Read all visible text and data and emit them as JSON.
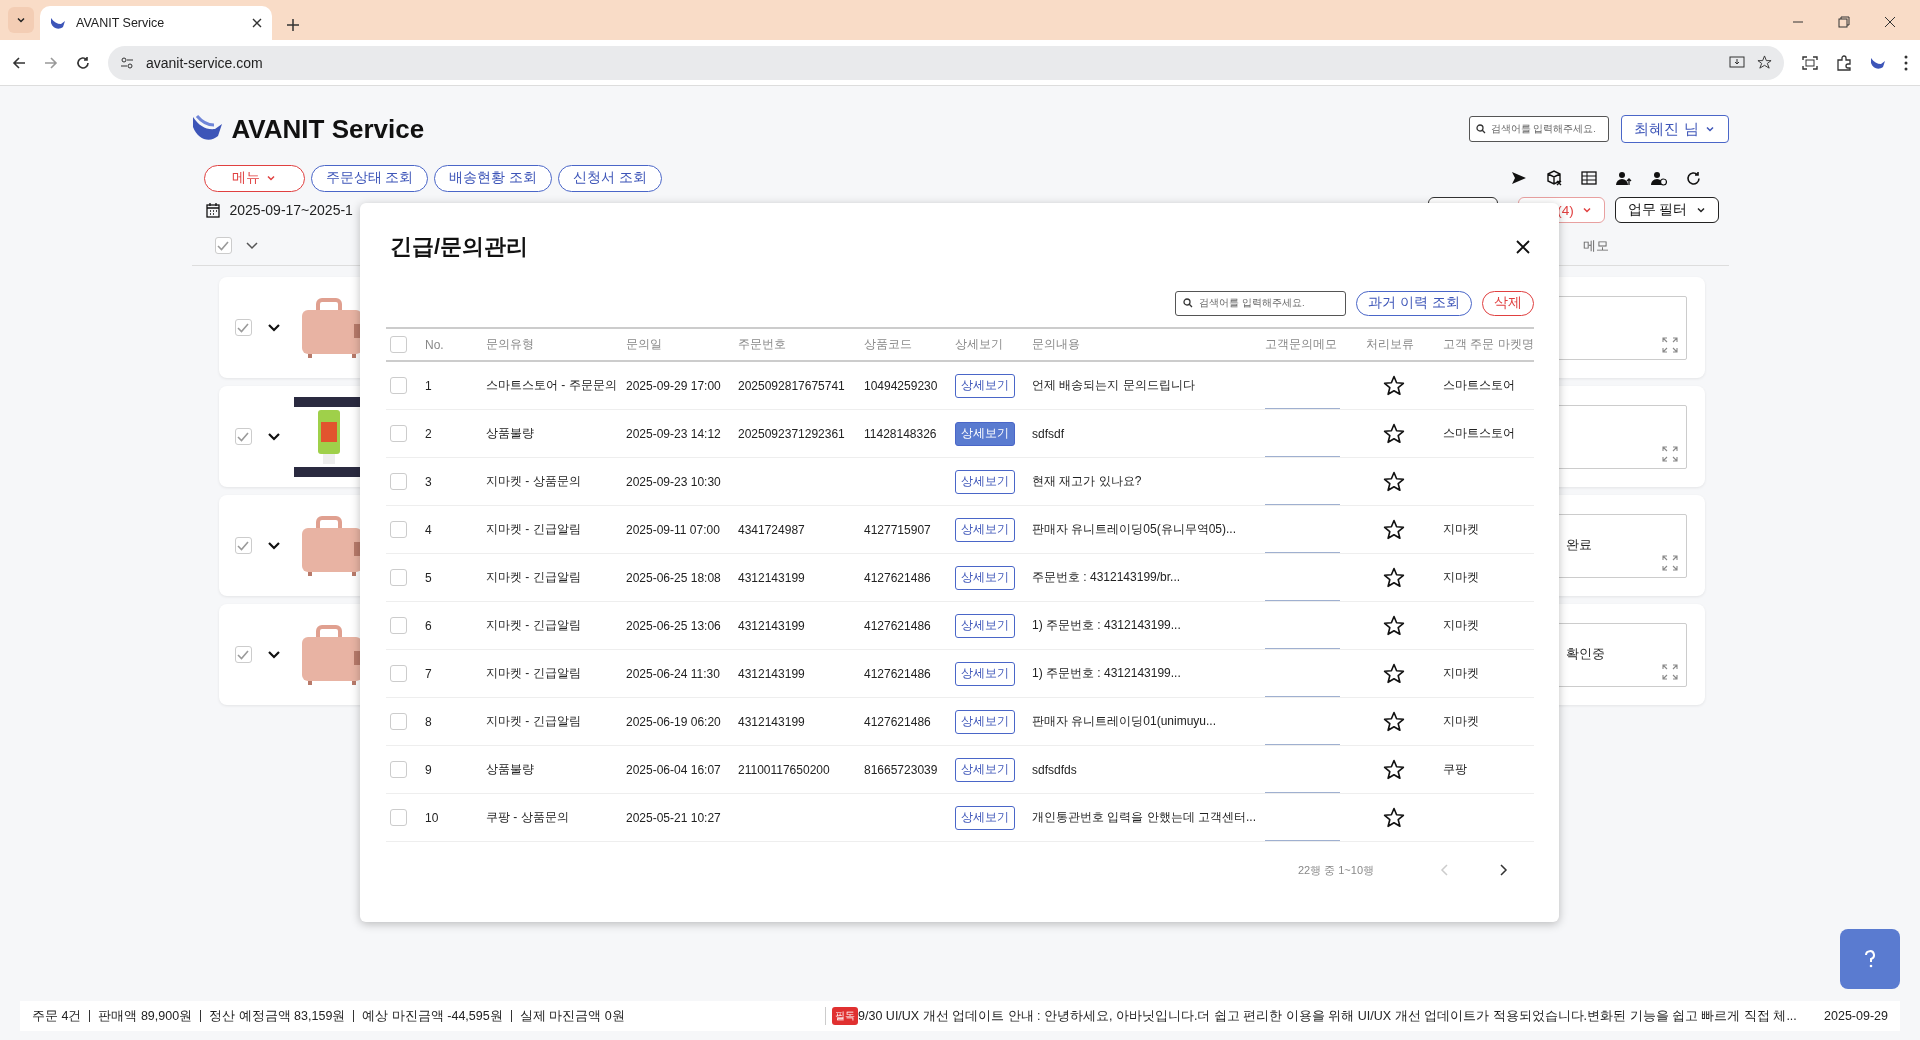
{
  "browser": {
    "tab_title": "AVANIT Service",
    "url": "avanit-service.com"
  },
  "header": {
    "brand": "AVANIT Service",
    "search": {
      "placeholder": "검색어를 입력해주세요."
    },
    "user": "최혜진 님"
  },
  "nav": [
    {
      "label": "메뉴",
      "kind": "menu"
    },
    {
      "label": "주문상태 조회",
      "kind": "link"
    },
    {
      "label": "배송현황 조회",
      "kind": "link"
    },
    {
      "label": "신청서 조회",
      "kind": "link"
    }
  ],
  "date_range": "2025-09-17~2025-1",
  "filters": [
    {
      "label": "(4)",
      "alert": true
    },
    {
      "label": "업무 필터",
      "alert": false
    }
  ],
  "list_header": {
    "checked": true,
    "memo": "메모"
  },
  "cards": [
    {
      "checked": true,
      "kind": "picture"
    },
    {
      "checked": true,
      "kind": "picture"
    },
    {
      "checked": true,
      "kind": "picture",
      "memo": "완료"
    },
    {
      "checked": true,
      "kind": "picture",
      "memo": "확인중"
    }
  ],
  "modal": {
    "title": "긴급/문의관리",
    "search": {
      "placeholder": "검색어를 입력해주세요."
    },
    "buttons": [
      {
        "label": "과거 이력 조회",
        "kind": "secondary"
      },
      {
        "label": "삭제",
        "kind": "danger"
      }
    ],
    "header_checked": false,
    "columns": [
      "No.",
      "문의유형",
      "문의일",
      "주문번호",
      "상품코드",
      "상세보기",
      "문의내용",
      "고객문의메모",
      "처리보류",
      "고객 주문 마켓명"
    ],
    "rows": [
      {
        "checked": false,
        "no": "1",
        "type": "스마트스토어 - 주문문의",
        "date": "2025-09-29 17:00",
        "order_no": "2025092817675741",
        "product_code": "10494259230",
        "detail": "상세보기",
        "hovered": false,
        "content": "언제 배송되는지 문의드립니다",
        "starred": false,
        "market": "스마트스토어"
      },
      {
        "checked": false,
        "no": "2",
        "type": "상품불량",
        "date": "2025-09-23 14:12",
        "order_no": "2025092371292361",
        "product_code": "11428148326",
        "detail": "상세보기",
        "hovered": true,
        "content": "sdfsdf",
        "starred": false,
        "market": "스마트스토어"
      },
      {
        "checked": false,
        "no": "3",
        "type": "지마켓 - 상품문의",
        "date": "2025-09-23 10:30",
        "detail": "상세보기",
        "hovered": false,
        "content": "현재 재고가 있나요?",
        "starred": false
      },
      {
        "checked": false,
        "no": "4",
        "type": "지마켓 - 긴급알림",
        "date": "2025-09-11 07:00",
        "order_no": "4341724987",
        "product_code": "4127715907",
        "detail": "상세보기",
        "hovered": false,
        "content": "판매자 유니트레이딩05(유니무역05)...",
        "starred": false,
        "market": "지마켓"
      },
      {
        "checked": false,
        "no": "5",
        "type": "지마켓 - 긴급알림",
        "date": "2025-06-25 18:08",
        "order_no": "4312143199",
        "product_code": "4127621486",
        "detail": "상세보기",
        "hovered": false,
        "content": "주문번호 : 4312143199/br...",
        "starred": false,
        "market": "지마켓"
      },
      {
        "checked": false,
        "no": "6",
        "type": "지마켓 - 긴급알림",
        "date": "2025-06-25 13:06",
        "order_no": "4312143199",
        "product_code": "4127621486",
        "detail": "상세보기",
        "hovered": false,
        "content": "1) 주문번호 : 4312143199...",
        "starred": false,
        "market": "지마켓"
      },
      {
        "checked": false,
        "no": "7",
        "type": "지마켓 - 긴급알림",
        "date": "2025-06-24 11:30",
        "order_no": "4312143199",
        "product_code": "4127621486",
        "detail": "상세보기",
        "hovered": false,
        "content": "1) 주문번호 : 4312143199...",
        "starred": false,
        "market": "지마켓"
      },
      {
        "checked": false,
        "no": "8",
        "type": "지마켓 - 긴급알림",
        "date": "2025-06-19 06:20",
        "order_no": "4312143199",
        "product_code": "4127621486",
        "detail": "상세보기",
        "hovered": false,
        "content": "판매자 유니트레이딩01(unimuyu...",
        "starred": false,
        "market": "지마켓"
      },
      {
        "checked": false,
        "no": "9",
        "type": "상품불량",
        "date": "2025-06-04 16:07",
        "order_no": "21100117650200",
        "product_code": "81665723039",
        "detail": "상세보기",
        "hovered": false,
        "content": "sdfsdfds",
        "starred": false,
        "market": "쿠팡"
      },
      {
        "checked": false,
        "no": "10",
        "type": "쿠팡 - 상품문의",
        "date": "2025-05-21 10:27",
        "detail": "상세보기",
        "hovered": false,
        "content": "개인통관번호 입력을 안했는데 고객센터...",
        "starred": false
      }
    ],
    "pagination": {
      "summary": "22행 중 1~10행",
      "prev_disabled": true,
      "next_disabled": false
    }
  },
  "status_bar": {
    "stats": [
      "주문 4건",
      "판매액 89,900원",
      "정산 예정금액 83,159원",
      "예상 마진금액 -44,595원",
      "실제 마진금액 0원"
    ],
    "notice": {
      "badge": "필독",
      "text": "9/30 UI/UX 개선 업데이트 안내 : 안녕하세요, 아바닛입니다.더 쉽고 편리한 이용을 위해 UI/UX 개선 업데이트가 적용되었습니다.변화된 기능을 쉽고 빠르게 직접 체..."
    },
    "date": "2025-09-29"
  }
}
